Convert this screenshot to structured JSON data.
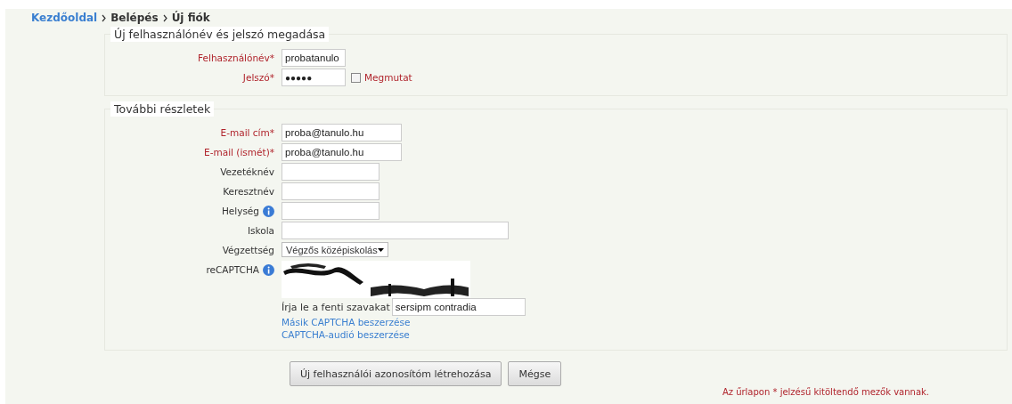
{
  "breadcrumb": [
    {
      "label": "Kezdőoldal",
      "kind": "link"
    },
    {
      "label": "Belépés",
      "kind": "text"
    },
    {
      "label": "Új fiók",
      "kind": "text"
    }
  ],
  "sections": [
    {
      "legend": "Új felhasználónév és jelszó megadása",
      "fields": [
        {
          "kind": "text",
          "label": "Felhasználónév*",
          "required": true,
          "info": false,
          "value": "probatanulo"
        },
        {
          "kind": "password",
          "label": "Jelszó*",
          "required": true,
          "info": false,
          "value": "●●●●●",
          "toggle": {
            "label": "Megmutat",
            "checked": false
          }
        }
      ]
    },
    {
      "legend": "További részletek",
      "fields": [
        {
          "kind": "text",
          "label": "E-mail cím*",
          "required": true,
          "info": false,
          "value": "proba@tanulo.hu"
        },
        {
          "kind": "text",
          "label": "E-mail (ismét)*",
          "required": true,
          "info": false,
          "value": "proba@tanulo.hu"
        },
        {
          "kind": "text",
          "label": "Vezetéknév",
          "required": false,
          "info": false
        },
        {
          "kind": "text",
          "label": "Keresztnév",
          "required": false,
          "info": false
        },
        {
          "kind": "text",
          "label": "Helység",
          "required": false,
          "info": true
        },
        {
          "kind": "text",
          "label": "Iskola",
          "required": false,
          "info": false
        },
        {
          "kind": "select",
          "label": "Végzettség",
          "required": false,
          "info": false,
          "value": "Végzős középiskolás"
        },
        {
          "kind": "captcha",
          "label": "reCAPTCHA",
          "required": false,
          "info": true,
          "prompt": "Írja le a fenti szavakat",
          "value": "sersipm contradia",
          "links": [
            "Másik CAPTCHA beszerzése",
            "CAPTCHA-audió beszerzése"
          ]
        }
      ]
    }
  ],
  "buttons": [
    "Új felhasználói azonosítóm létrehozása",
    "Mégse"
  ],
  "note": "Az űrlapon * jelzésű kitöltendő mezők vannak."
}
